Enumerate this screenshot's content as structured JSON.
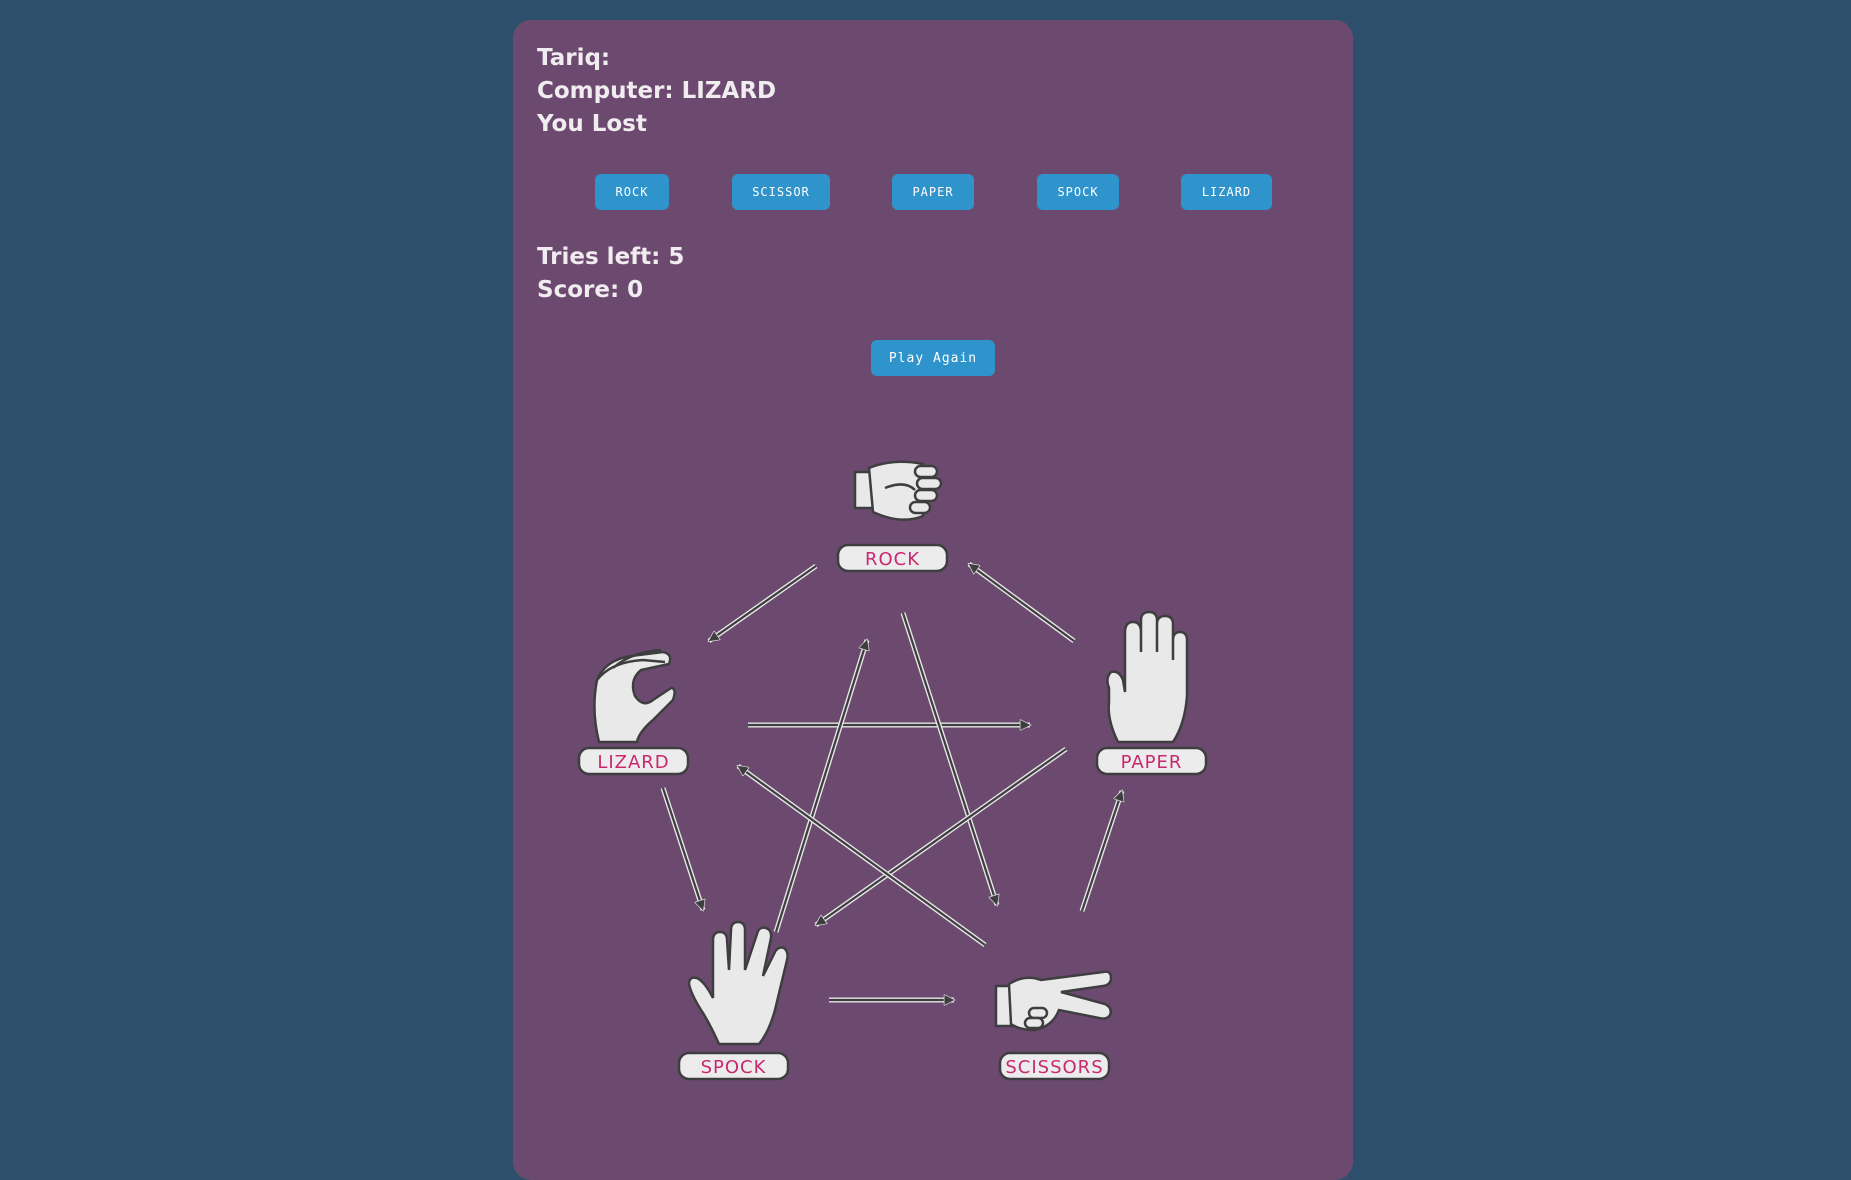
{
  "status": {
    "player_line": "Tariq:",
    "computer_line": "Computer: LIZARD",
    "result_line": "You Lost"
  },
  "choices": [
    "ROCK",
    "SCISSOR",
    "PAPER",
    "SPOCK",
    "LIZARD"
  ],
  "stats": {
    "tries_line": "Tries left: 5",
    "score_line": "Score: 0"
  },
  "play_again_label": "Play Again",
  "diagram": {
    "labels": {
      "rock": "ROCK",
      "paper": "PAPER",
      "scissors": "SCISSORS",
      "spock": "SPOCK",
      "lizard": "LIZARD"
    },
    "icons": {
      "rock": "fist-icon",
      "paper": "open-hand-icon",
      "scissors": "scissors-hand-icon",
      "spock": "vulcan-salute-icon",
      "lizard": "lizard-hand-icon"
    }
  },
  "colors": {
    "page_background": "#2e4f6c",
    "panel_background": "#6c4a6f",
    "button": "#2f93cc",
    "label_text": "#c8286f"
  }
}
